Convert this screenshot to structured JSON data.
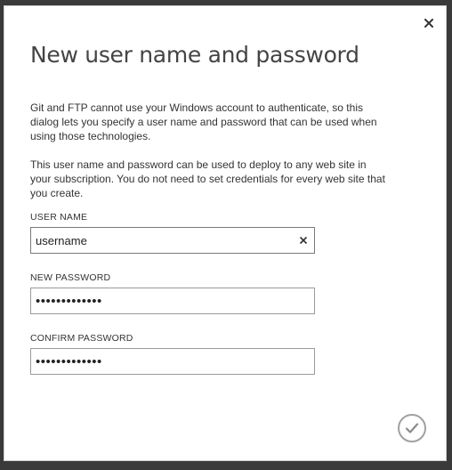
{
  "dialog": {
    "title": "New user name and password",
    "paragraph1": "Git and FTP cannot use your Windows account to authenticate, so this dialog lets you specify a user name and password that can be used when using those technologies.",
    "paragraph2": "This user name and password can be used to deploy to any web site in your subscription. You do not need to set credentials for every web site that you create.",
    "close_icon": "close-icon",
    "ok_icon": "checkmark-icon"
  },
  "fields": {
    "username": {
      "label": "USER NAME",
      "value": "username",
      "clear_icon": "clear-icon"
    },
    "new_password": {
      "label": "NEW PASSWORD",
      "value": "•••••••••••••"
    },
    "confirm_password": {
      "label": "CONFIRM PASSWORD",
      "value": "•••••••••••••"
    }
  },
  "colors": {
    "dialog_background": "#ffffff",
    "backdrop": "#3a3a3a",
    "title_text": "#444444",
    "ok_button_ring": "#a0a0a0"
  }
}
